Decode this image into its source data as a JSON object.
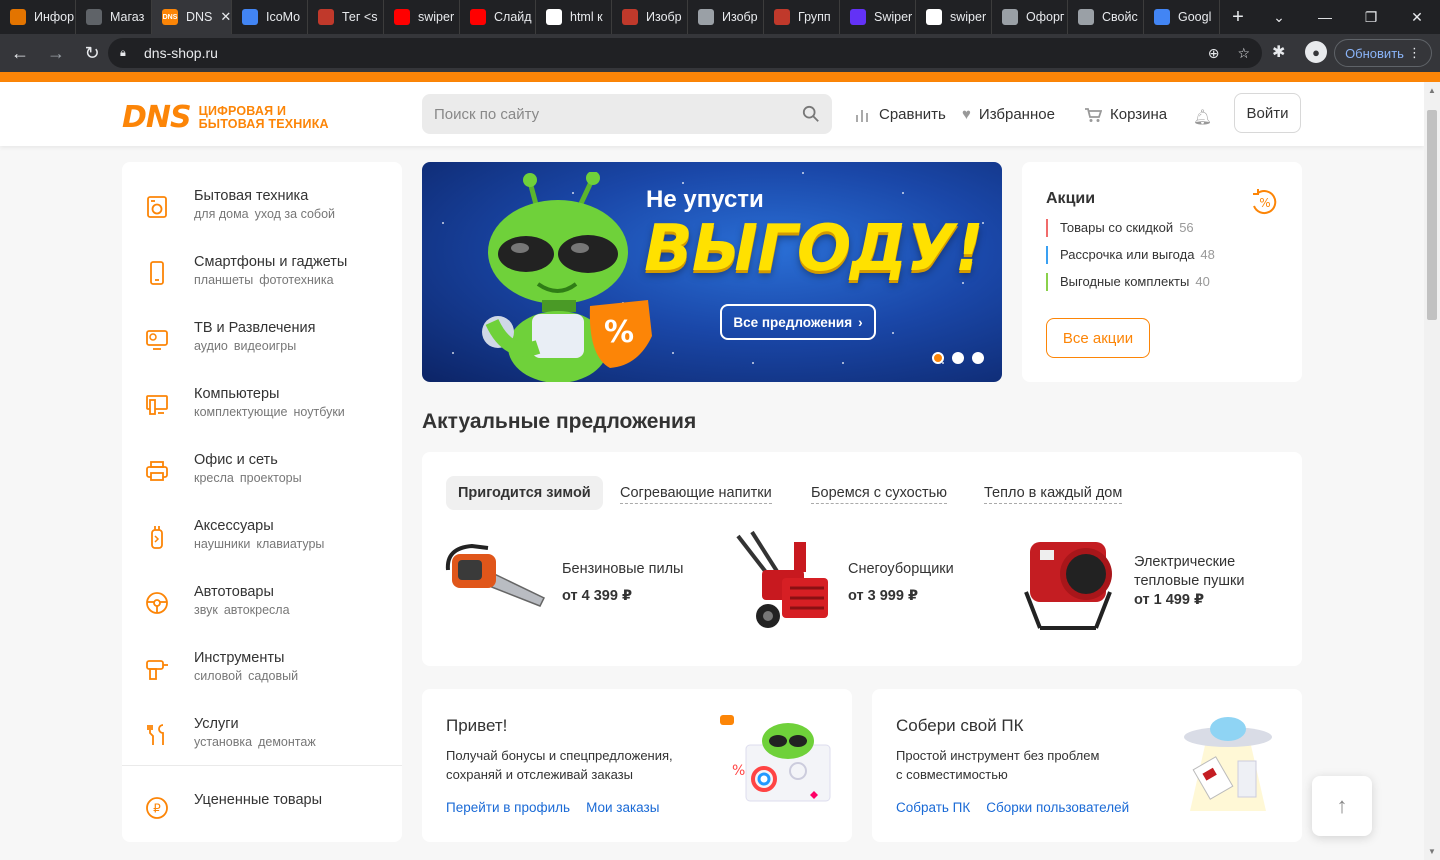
{
  "browser": {
    "tabs": [
      {
        "label": "Инфор",
        "color": "#e37400"
      },
      {
        "label": "Магаз",
        "color": "#5f6368"
      },
      {
        "label": "DNS",
        "color": "#fc8507",
        "active": true
      },
      {
        "label": "IcoMo",
        "color": "#4285f4"
      },
      {
        "label": "Тег <s",
        "color": "#c0392b"
      },
      {
        "label": "swiper",
        "color": "#ff0000"
      },
      {
        "label": "Слайд",
        "color": "#ff0000"
      },
      {
        "label": "html к",
        "color": "#ffffff"
      },
      {
        "label": "Изобр",
        "color": "#c0392b"
      },
      {
        "label": "Изобр",
        "color": "#9aa0a6"
      },
      {
        "label": "Групп",
        "color": "#c0392b"
      },
      {
        "label": "Swiper",
        "color": "#6332f6"
      },
      {
        "label": "swiper",
        "color": "#ffffff"
      },
      {
        "label": "Офорг",
        "color": "#9aa0a6"
      },
      {
        "label": "Свойс",
        "color": "#9aa0a6"
      },
      {
        "label": "Googl",
        "color": "#4285f4"
      }
    ],
    "active_tab_favicon": "DNS",
    "url": "dns-shop.ru",
    "update_label": "Обновить"
  },
  "header": {
    "logo_text": "DNS",
    "logo_tag_line1": "ЦИФРОВАЯ И",
    "logo_tag_line2": "БЫТОВАЯ ТЕХНИКА",
    "search_placeholder": "Поиск по сайту",
    "compare": "Сравнить",
    "favorites": "Избранное",
    "cart": "Корзина",
    "login": "Войти",
    "accent": "#fc8507"
  },
  "sidebar": {
    "categories": [
      {
        "title": "Бытовая техника",
        "sub": [
          "для дома",
          "уход за собой"
        ],
        "icon": "appliance-icon"
      },
      {
        "title": "Смартфоны и гаджеты",
        "sub": [
          "планшеты",
          "фототехника"
        ],
        "icon": "smartphone-icon"
      },
      {
        "title": "ТВ и Развлечения",
        "sub": [
          "аудио",
          "видеоигры"
        ],
        "icon": "tv-icon"
      },
      {
        "title": "Компьютеры",
        "sub": [
          "комплектующие",
          "ноутбуки"
        ],
        "icon": "computer-icon"
      },
      {
        "title": "Офис и сеть",
        "sub": [
          "кресла",
          "проекторы"
        ],
        "icon": "printer-icon"
      },
      {
        "title": "Аксессуары",
        "sub": [
          "наушники",
          "клавиатуры"
        ],
        "icon": "accessories-icon"
      },
      {
        "title": "Автотовары",
        "sub": [
          "звук",
          "автокресла"
        ],
        "icon": "steering-wheel-icon"
      },
      {
        "title": "Инструменты",
        "sub": [
          "силовой",
          "садовый"
        ],
        "icon": "drill-icon"
      },
      {
        "title": "Услуги",
        "sub": [
          "установка",
          "демонтаж"
        ],
        "icon": "tools-icon"
      }
    ],
    "discounted": "Уцененные товары"
  },
  "banner": {
    "line1": "Не упусти",
    "line2": "ВЫГОДУ!",
    "button": "Все предложения",
    "badge": "%"
  },
  "promo": {
    "title": "Акции",
    "items": [
      {
        "label": "Товары со скидкой",
        "count": "56",
        "color": "#f06b6b"
      },
      {
        "label": "Рассрочка или выгода",
        "count": "48",
        "color": "#3aa0f2"
      },
      {
        "label": "Выгодные комплекты",
        "count": "40",
        "color": "#8ad14b"
      }
    ],
    "all_button": "Все акции"
  },
  "offers": {
    "section_title": "Актуальные предложения",
    "tabs": [
      "Пригодится зимой",
      "Согревающие напитки",
      "Боремся с сухостью",
      "Тепло в каждый дом"
    ],
    "products": [
      {
        "name_line1": "Бензиновые пилы",
        "name_line2": "",
        "price": "от 4 399 ₽"
      },
      {
        "name_line1": "Снегоуборщики",
        "name_line2": "",
        "price": "от 3 999 ₽"
      },
      {
        "name_line1": "Электрические",
        "name_line2": "тепловые пушки",
        "price": "от 1 499 ₽"
      }
    ]
  },
  "cards": {
    "profile": {
      "title": "Привет!",
      "text_line1": "Получай бонусы и спецпредложения,",
      "text_line2": "сохраняй и отслеживай заказы",
      "link1": "Перейти в профиль",
      "link2": "Мои заказы"
    },
    "pc": {
      "title": "Собери свой ПК",
      "text_line1": "Простой инструмент без проблем",
      "text_line2": "с совместимостью",
      "link1": "Собрать ПК",
      "link2": "Сборки пользователей"
    }
  },
  "to_top": "↑"
}
